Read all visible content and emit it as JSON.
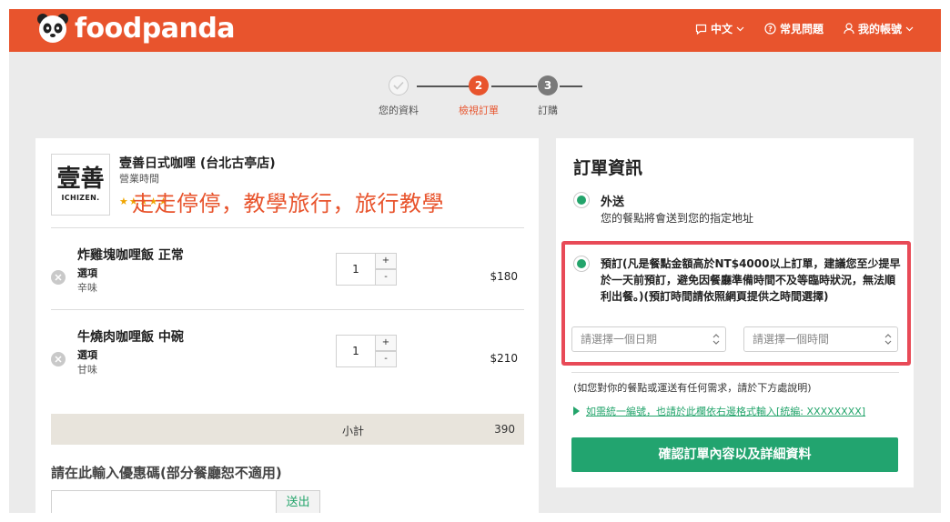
{
  "header": {
    "brand": "foodpanda",
    "nav": {
      "language": "中文",
      "faq": "常見問題",
      "account": "我的帳號"
    }
  },
  "stepper": {
    "steps": [
      {
        "label": "您的資料",
        "number": "",
        "state": "done"
      },
      {
        "label": "檢視訂單",
        "number": "2",
        "state": "active"
      },
      {
        "label": "訂購",
        "number": "3",
        "state": "pending"
      }
    ]
  },
  "restaurant": {
    "name": "壹善日式咖哩 (台北古亭店)",
    "hours_label": "營業時間",
    "logo_kanji": "壹善",
    "logo_brand": "ICHIZEN.",
    "rating_stars": "★★★★★"
  },
  "overlay_text": "走走停停，教學旅行，旅行教學",
  "cart": {
    "items": [
      {
        "name": "炸雞塊咖哩飯 正常",
        "option_label": "選項",
        "option_value": "辛味",
        "quantity": "1",
        "price": "$180"
      },
      {
        "name": "牛燒肉咖哩飯 中碗",
        "option_label": "選項",
        "option_value": "甘味",
        "quantity": "1",
        "price": "$210"
      }
    ],
    "qty_plus": "+",
    "qty_minus": "-",
    "subtotal_label": "小計",
    "subtotal_value": "390"
  },
  "coupon": {
    "title": "請在此輸入優惠碼(部分餐廳恕不適用)",
    "placeholder": "",
    "button": "送出"
  },
  "order_info": {
    "title": "訂單資訊",
    "delivery_title": "外送",
    "delivery_desc": "您的餐點將會送到您的指定地址",
    "preorder_text": "預訂(凡是餐點金額高於NT$4000以上訂單，建議您至少提早於一天前預訂，避免因餐廳準備時間不及等臨時狀況，無法順利出餐。)(預訂時間請依照網頁提供之時間選擇)",
    "date_select": "請選擇一個日期",
    "time_select": "請選擇一個時間",
    "note": "(如您對你的餐點或運送有任何需求，請於下方處說明)",
    "tax_link": "如需統一編號，也請於此欄依右邊格式輸入[統編: XXXXXXXX]",
    "confirm_button": "確認訂單內容以及詳細資料"
  },
  "colors": {
    "brand": "#e8542d",
    "accent_green": "#23a46b",
    "highlight_red": "#e84a57"
  }
}
